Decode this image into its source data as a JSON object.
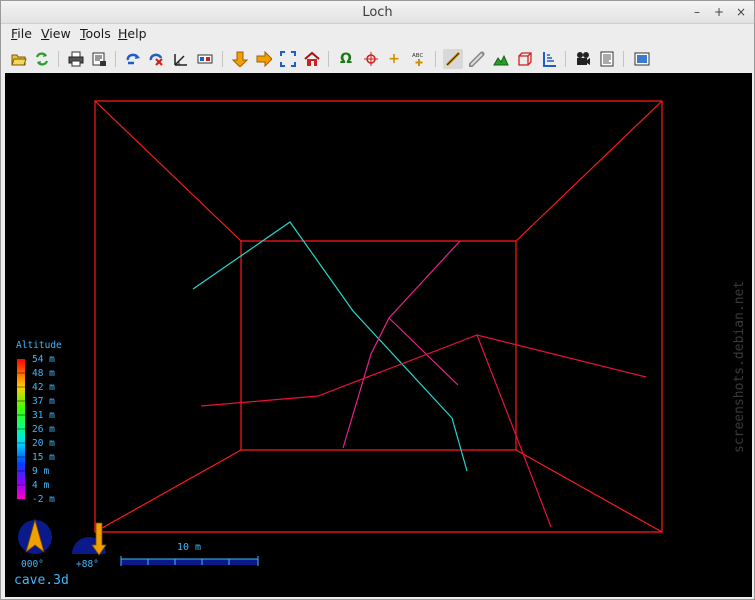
{
  "window": {
    "title": "Loch"
  },
  "menu": {
    "file": {
      "mnemonic": "F",
      "rest": "ile"
    },
    "view": {
      "mnemonic": "V",
      "rest": "iew"
    },
    "tools": {
      "mnemonic": "T",
      "rest": "ools"
    },
    "help": {
      "mnemonic": "H",
      "rest": "elp"
    }
  },
  "toolbar": {
    "icons": [
      "open-file-icon",
      "reload-icon",
      "print-icon",
      "export-icon",
      "rotate-icon",
      "stop-rotation-icon",
      "tilt-icon",
      "elevation-icon",
      "plan-view-icon",
      "elevation-view-icon",
      "zoom-fit-icon",
      "home-view-icon",
      "omega-entrances-icon",
      "fixed-points-icon",
      "crosses-icon",
      "station-names-icon",
      "centreline-icon",
      "tubes-icon",
      "surface-icon",
      "bounding-box-icon",
      "depth-icon",
      "movie-icon",
      "side-panel-icon",
      "fullscreen-icon"
    ],
    "colors": {
      "orange": "#f0a000",
      "green": "#28a028",
      "blue": "#1e5ec8",
      "red": "#d02020"
    }
  },
  "viewport": {
    "background": "#000000",
    "legend": {
      "title": "Altitude",
      "labels": [
        "54 m",
        "48 m",
        "42 m",
        "37 m",
        "31 m",
        "26 m",
        "20 m",
        "15 m",
        "9 m",
        "4 m",
        "-2 m"
      ]
    },
    "compass": {
      "bearing_label": "000°"
    },
    "clino": {
      "tilt_label": "+88°"
    },
    "scale_bar": {
      "label": "10 m"
    },
    "filename": "cave.3d",
    "watermark": "screenshots.debian.net",
    "colors": {
      "box": "#ff1a1a",
      "text": "#3fb8ff",
      "cyan_leg": "#22d8d0",
      "magenta_leg": "#e8208c",
      "red_leg": "#e8103c"
    }
  }
}
